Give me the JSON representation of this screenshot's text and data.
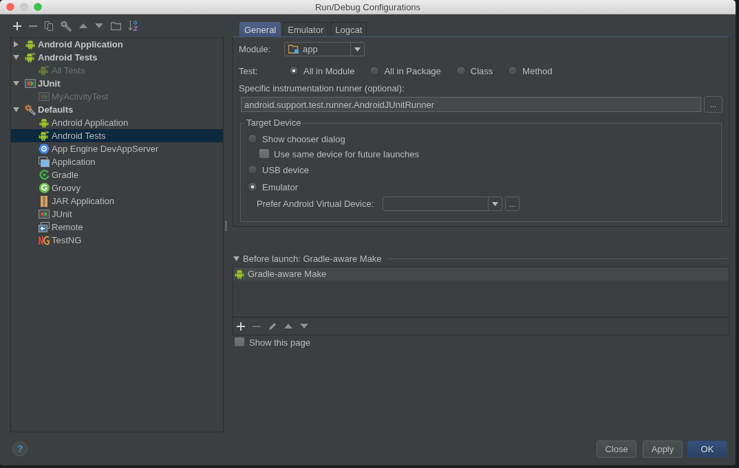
{
  "window": {
    "title": "Run/Debug Configurations"
  },
  "tree": [
    {
      "label": "Android Application",
      "kind": "android",
      "expanded": false,
      "selected": false,
      "temporary": false
    },
    {
      "label": "Android Tests",
      "kind": "android-test",
      "expanded": true,
      "selected": false,
      "temporary": false,
      "children": [
        {
          "label": "All Tests",
          "kind": "android-test",
          "selected": false,
          "temporary": true
        }
      ]
    },
    {
      "label": "JUnit",
      "kind": "junit",
      "expanded": true,
      "selected": false,
      "temporary": false,
      "children": [
        {
          "label": "MyActivityTest",
          "kind": "junit",
          "selected": false,
          "temporary": true
        }
      ]
    },
    {
      "label": "Defaults",
      "kind": "defaults",
      "expanded": true,
      "selected": false,
      "temporary": false,
      "children": [
        {
          "label": "Android Application",
          "kind": "android",
          "selected": false,
          "temporary": false
        },
        {
          "label": "Android Tests",
          "kind": "android-test",
          "selected": true,
          "temporary": false
        },
        {
          "label": "App Engine DevAppServer",
          "kind": "appengine",
          "selected": false,
          "temporary": false
        },
        {
          "label": "Application",
          "kind": "application",
          "selected": false,
          "temporary": false
        },
        {
          "label": "Gradle",
          "kind": "gradle",
          "selected": false,
          "temporary": false
        },
        {
          "label": "Groovy",
          "kind": "groovy",
          "selected": false,
          "temporary": false
        },
        {
          "label": "JAR Application",
          "kind": "jar",
          "selected": false,
          "temporary": false
        },
        {
          "label": "JUnit",
          "kind": "junit",
          "selected": false,
          "temporary": false
        },
        {
          "label": "Remote",
          "kind": "remote",
          "selected": false,
          "temporary": false
        },
        {
          "label": "TestNG",
          "kind": "testng",
          "selected": false,
          "temporary": false
        }
      ]
    }
  ],
  "tabs": [
    {
      "label": "General",
      "selected": true
    },
    {
      "label": "Emulator",
      "selected": false
    },
    {
      "label": "Logcat",
      "selected": false
    }
  ],
  "general": {
    "module": {
      "label": "Module:",
      "value": "app"
    },
    "test": {
      "label": "Test:",
      "options": [
        {
          "label": "All in Module",
          "selected": true
        },
        {
          "label": "All in Package",
          "selected": false
        },
        {
          "label": "Class",
          "selected": false
        },
        {
          "label": "Method",
          "selected": false
        }
      ]
    },
    "runner": {
      "label": "Specific instrumentation runner (optional):",
      "value": "android.support.test.runner.AndroidJUnitRunner",
      "browse_button": "..."
    },
    "target_device": {
      "title": "Target Device",
      "options": [
        {
          "label": "Show chooser dialog",
          "selected": false,
          "sub_option": {
            "label": "Use same device for future launches",
            "checked": false
          }
        },
        {
          "label": "USB device",
          "selected": false
        },
        {
          "label": "Emulator",
          "selected": true
        }
      ],
      "avd": {
        "label": "Prefer Android Virtual Device:",
        "browse_button": "..."
      }
    }
  },
  "before_launch": {
    "title": "Before launch: Gradle-aware Make",
    "expanded": true,
    "tasks": [
      {
        "label": "Gradle-aware Make",
        "selected": true
      }
    ]
  },
  "show_this_page": {
    "label": "Show this page",
    "checked": false
  },
  "help_button": "?",
  "buttons": [
    {
      "label": "Close",
      "default": false
    },
    {
      "label": "Apply",
      "default": false
    },
    {
      "label": "OK",
      "default": true
    }
  ]
}
